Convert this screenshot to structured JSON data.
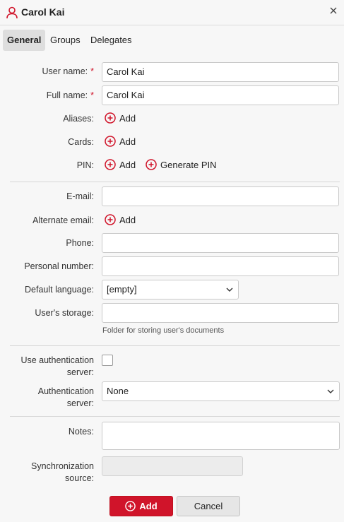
{
  "header": {
    "title": "Carol Kai",
    "icon": "user-icon",
    "close_icon": "close-icon"
  },
  "tabs": [
    {
      "label": "General",
      "active": true
    },
    {
      "label": "Groups",
      "active": false
    },
    {
      "label": "Delegates",
      "active": false
    }
  ],
  "form": {
    "user_name": {
      "label": "User name:",
      "required_mark": "*",
      "value": "Carol Kai"
    },
    "full_name": {
      "label": "Full name:",
      "required_mark": "*",
      "value": "Carol Kai"
    },
    "aliases": {
      "label": "Aliases:",
      "add_label": "Add"
    },
    "cards": {
      "label": "Cards:",
      "add_label": "Add"
    },
    "pin": {
      "label": "PIN:",
      "add_label": "Add",
      "generate_label": "Generate PIN"
    },
    "email": {
      "label": "E-mail:",
      "value": ""
    },
    "alternate_email": {
      "label": "Alternate email:",
      "add_label": "Add"
    },
    "phone": {
      "label": "Phone:",
      "value": ""
    },
    "personal_number": {
      "label": "Personal number:",
      "value": ""
    },
    "default_language": {
      "label": "Default language:",
      "value": "[empty]"
    },
    "users_storage": {
      "label": "User's storage:",
      "value": "",
      "hint": "Folder for storing user's documents"
    },
    "use_auth_server": {
      "label": "Use authentication server:",
      "checked": false
    },
    "auth_server": {
      "label": "Authentication server:",
      "value": "None"
    },
    "notes": {
      "label": "Notes:",
      "value": ""
    },
    "sync_source": {
      "label": "Synchronization source:",
      "value": ""
    }
  },
  "footer": {
    "add_label": "Add",
    "cancel_label": "Cancel"
  },
  "colors": {
    "accent": "#d0142a",
    "background": "#f7f7f7"
  }
}
